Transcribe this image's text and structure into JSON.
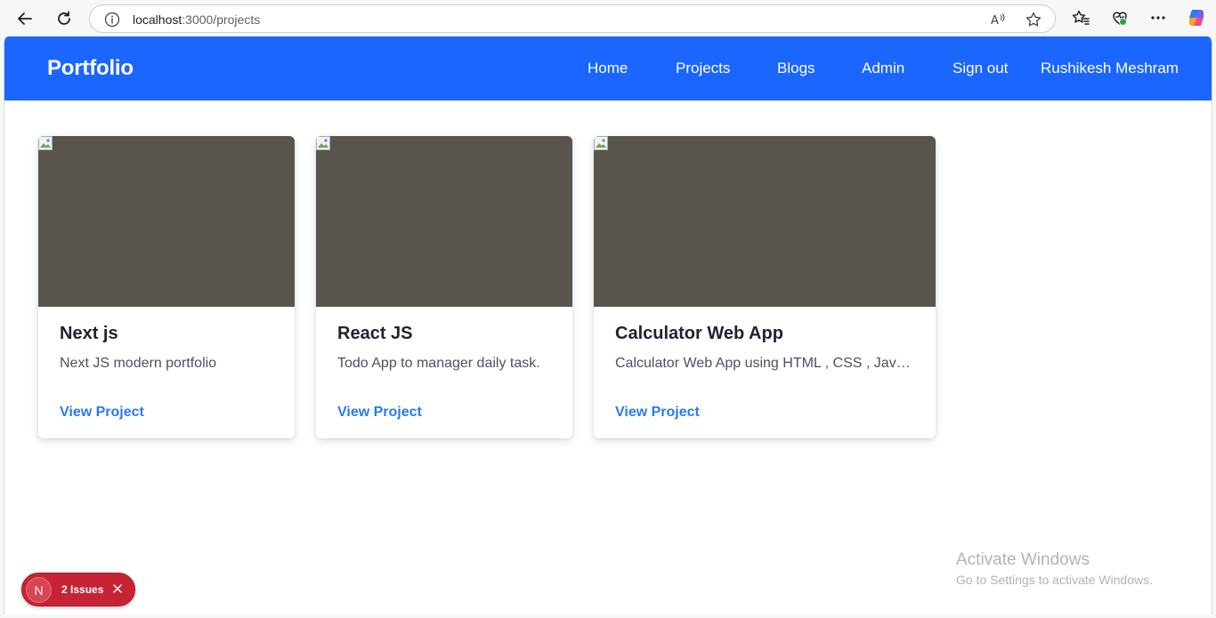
{
  "browser": {
    "url_host": "localhost",
    "url_path": ":3000/projects"
  },
  "header": {
    "brand": "Portfolio",
    "nav": [
      "Home",
      "Projects",
      "Blogs",
      "Admin",
      "Sign out",
      "Rushikesh Meshram"
    ]
  },
  "projects": [
    {
      "title": "Next js",
      "description": "Next JS modern portfolio",
      "link": "View Project"
    },
    {
      "title": "React JS",
      "description": "Todo App to manager daily task.",
      "link": "View Project"
    },
    {
      "title": "Calculator Web App",
      "description": "Calculator Web App using HTML , CSS , JavaScript",
      "link": "View Project"
    }
  ],
  "dev_overlay": {
    "logo": "N",
    "issues_label": "2 Issues"
  },
  "watermark": {
    "title": "Activate Windows",
    "subtitle": "Go to Settings to activate Windows."
  },
  "colors": {
    "header_bg": "#1a66ff",
    "link": "#2b79ee",
    "image_placeholder": "#58554f",
    "issues_bg": "#c62434"
  },
  "icons": {
    "back": "arrow-left-icon",
    "reload": "reload-icon",
    "info": "info-icon",
    "read_aloud": "read-aloud-icon",
    "favorite": "star-icon",
    "favorites_bar": "favorites-icon",
    "extensions": "browser-essentials-icon",
    "menu": "more-icon",
    "copilot": "copilot-icon"
  }
}
